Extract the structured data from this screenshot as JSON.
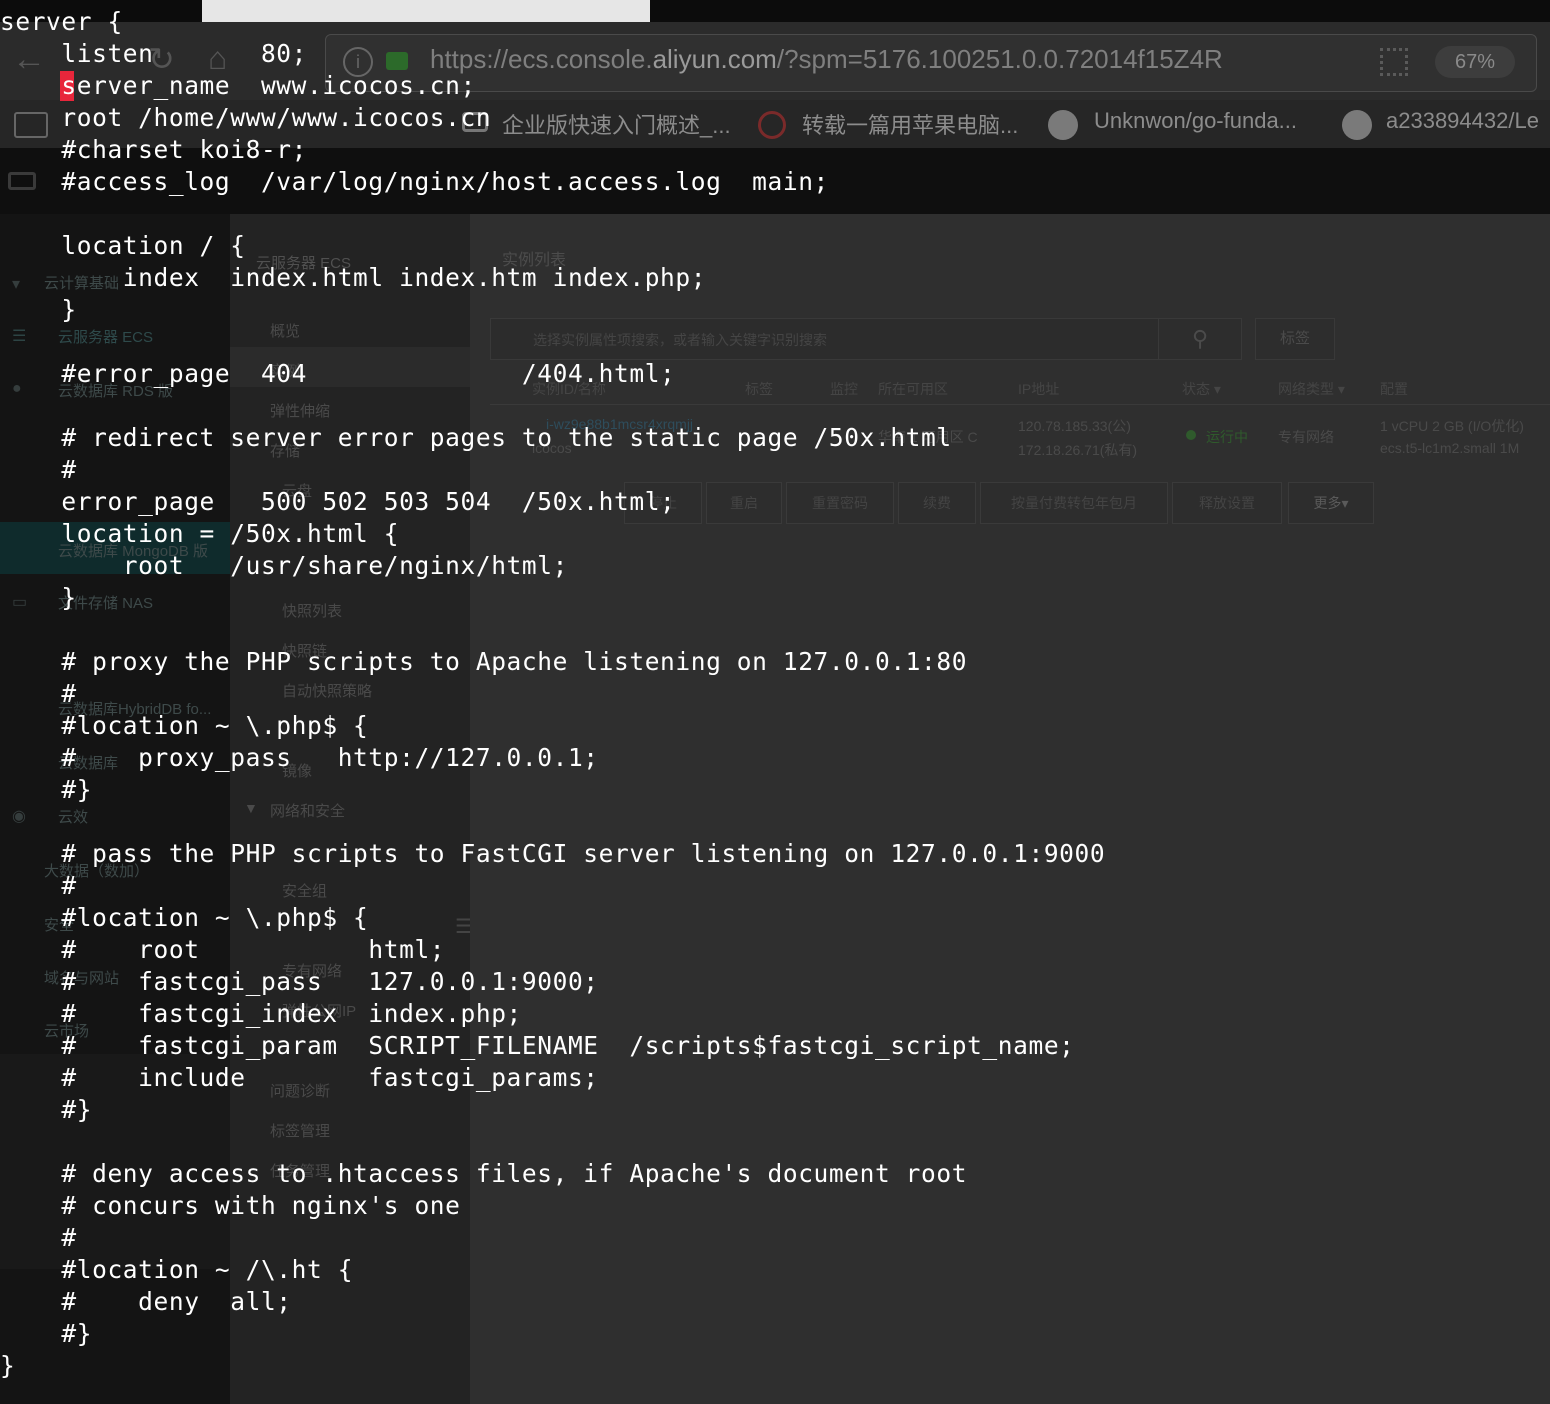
{
  "browser": {
    "url_prefix": "https://ecs.console.",
    "url_host": "aliyun.com",
    "url_rest": "/?spm=5176.100251.0.0.72014f15Z4R",
    "zoom": "67%",
    "bookmarks": [
      "企业版快速入门概述_...",
      "转载一篇用苹果电脑...",
      "Unknwon/go-funda...",
      "a233894432/Le"
    ],
    "left_nav": [
      "云计算基础",
      "云服务器 ECS",
      "云数据库 RDS 版",
      "云数据库 MongoDB 版",
      "文件存储 NAS",
      "云数据库HybridDB fo...",
      "云数据库",
      "云效",
      "大数据（数加）",
      "安全",
      "域名与网站",
      "云市场"
    ],
    "mid_nav": {
      "title": "云服务器 ECS",
      "items": [
        "概览",
        "实例",
        "弹性伸缩",
        "存储",
        "云盘",
        "快照列表",
        "快照链",
        "自动快照策略",
        "镜像",
        "网络和安全",
        "安全组",
        "专有网络",
        "弹性公网IP",
        "问题诊断",
        "标签管理",
        "任务管理"
      ]
    },
    "content": {
      "title": "实例列表",
      "search_placeholder": "选择实例属性项搜索，或者输入关键字识别搜索",
      "tag_button": "标签",
      "headers": [
        "实例ID/名称",
        "标签",
        "监控",
        "所在可用区",
        "IP地址",
        "状态 ▾",
        "网络类型 ▾",
        "配置"
      ],
      "row": {
        "id": "i-wz9e88b1mcsr4xrqmjj",
        "name": "icocos",
        "zone": "华南 1 可用区 C",
        "ip_public": "120.78.185.33(公)",
        "ip_private": "172.18.26.71(私有)",
        "status": "运行中",
        "network": "专有网络",
        "config1": "1 vCPU 2 GB (I/O优化)",
        "config2": "ecs.t5-lc1m2.small  1M"
      },
      "actions": [
        "停止",
        "重启",
        "重置密码",
        "续费",
        "按量付费转包年包月",
        "释放设置",
        "更多▾"
      ]
    }
  },
  "terminal": {
    "lines": [
      "server {",
      "    listen       80;",
      "    server_name  www.icocos.cn;",
      "    root /home/www/www.icocos.cn",
      "    #charset koi8-r;",
      "    #access_log  /var/log/nginx/host.access.log  main;",
      "",
      "    location / {",
      "        index  index.html index.htm index.php;",
      "    }",
      "",
      "    #error_page  404              /404.html;",
      "",
      "    # redirect server error pages to the static page /50x.html",
      "    #",
      "    error_page   500 502 503 504  /50x.html;",
      "    location = /50x.html {",
      "        root   /usr/share/nginx/html;",
      "    }",
      "",
      "    # proxy the PHP scripts to Apache listening on 127.0.0.1:80",
      "    #",
      "    #location ~ \\.php$ {",
      "    #    proxy_pass   http://127.0.0.1;",
      "    #}",
      "",
      "    # pass the PHP scripts to FastCGI server listening on 127.0.0.1:9000",
      "    #",
      "    #location ~ \\.php$ {",
      "    #    root           html;",
      "    #    fastcgi_pass   127.0.0.1:9000;",
      "    #    fastcgi_index  index.php;",
      "    #    fastcgi_param  SCRIPT_FILENAME  /scripts$fastcgi_script_name;",
      "    #    include        fastcgi_params;",
      "    #}",
      "",
      "    # deny access to .htaccess files, if Apache's document root",
      "    # concurs with nginx's one",
      "    #",
      "    #location ~ /\\.ht {",
      "    #    deny  all;",
      "    #}",
      "}"
    ]
  }
}
